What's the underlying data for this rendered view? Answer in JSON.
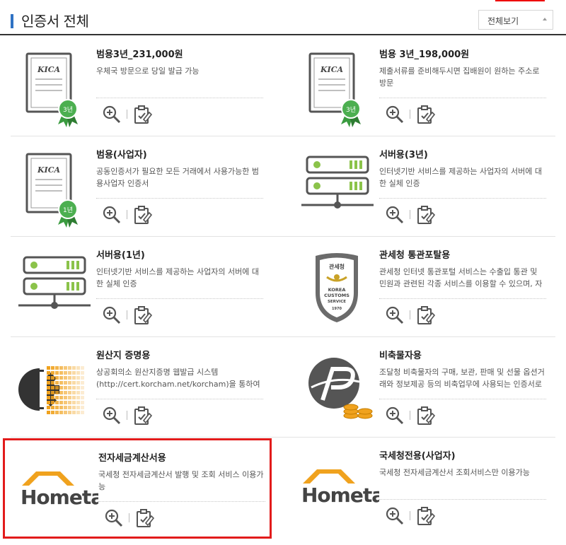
{
  "header": {
    "title": "인증서 전체",
    "filter_label": "전체보기"
  },
  "cards": [
    {
      "title": "범용3년_231,000원",
      "desc": "우체국 방문으로 당일 발급 가능",
      "icon": "kica-certificate-icon",
      "badge": "3년",
      "logo": "KICA"
    },
    {
      "title": "범용 3년_198,000원",
      "desc": "제출서류를 준비해두시면 집배원이 원하는 주소로 방문",
      "icon": "kica-certificate-icon",
      "badge": "3년",
      "logo": "KICA"
    },
    {
      "title": "범용(사업자)",
      "desc": "공동인증서가 필요한 모든 거래에서 사용가능한 범용사업자 인증서",
      "icon": "kica-certificate-icon",
      "badge": "1년",
      "logo": "KICA"
    },
    {
      "title": "서버용(3년)",
      "desc": "인터넷기반 서비스를 제공하는 사업자의 서버에 대한 실체 인증",
      "icon": "server-icon"
    },
    {
      "title": "서버용(1년)",
      "desc": "인터넷기반 서비스를 제공하는 사업자의 서버에 대한 실체 인증",
      "icon": "server-icon"
    },
    {
      "title": "관세청 통관포탈용",
      "desc": "관세청 인터넷 통관포털 서비스는 수출입 통관 및 민원과 관련된 각종 서비스를 이용할 수 있으며, 자",
      "icon": "customs-shield-icon",
      "shield_text": [
        "관세청",
        "KOREA",
        "CUSTOMS",
        "SERVICE",
        "1970"
      ]
    },
    {
      "title": "원산지 증명용",
      "desc": "상공회의소 원산지증명 웹발급 시스템(http://cert.korcham.net/korcham)을 통하여 원산지증",
      "icon": "gear-icon"
    },
    {
      "title": "비축물자용",
      "desc": "조달청 비축물자의 구매, 보관, 판매 및 선물 옵션거래와 정보제공 등의 비축업무에 사용되는 인증서로",
      "icon": "stockpile-coin-icon"
    },
    {
      "title": "전자세금계산서용",
      "desc": "국세청 전자세금계산서 발행 및 조회 서비스 이용가능",
      "icon": "hometax-logo-icon",
      "logo": "Hometax."
    },
    {
      "title": "국세청전용(사업자)",
      "desc": "국세청 전자세금계산서 조회서비스만 이용가능",
      "icon": "hometax-logo-icon",
      "logo": "Hometax."
    }
  ],
  "colors": {
    "accent": "#2f72c4",
    "selection": "#e21b1b",
    "badge_green": "#3a9b3f",
    "server_green": "#8bc34a",
    "hometax_orange": "#f0a21e"
  }
}
